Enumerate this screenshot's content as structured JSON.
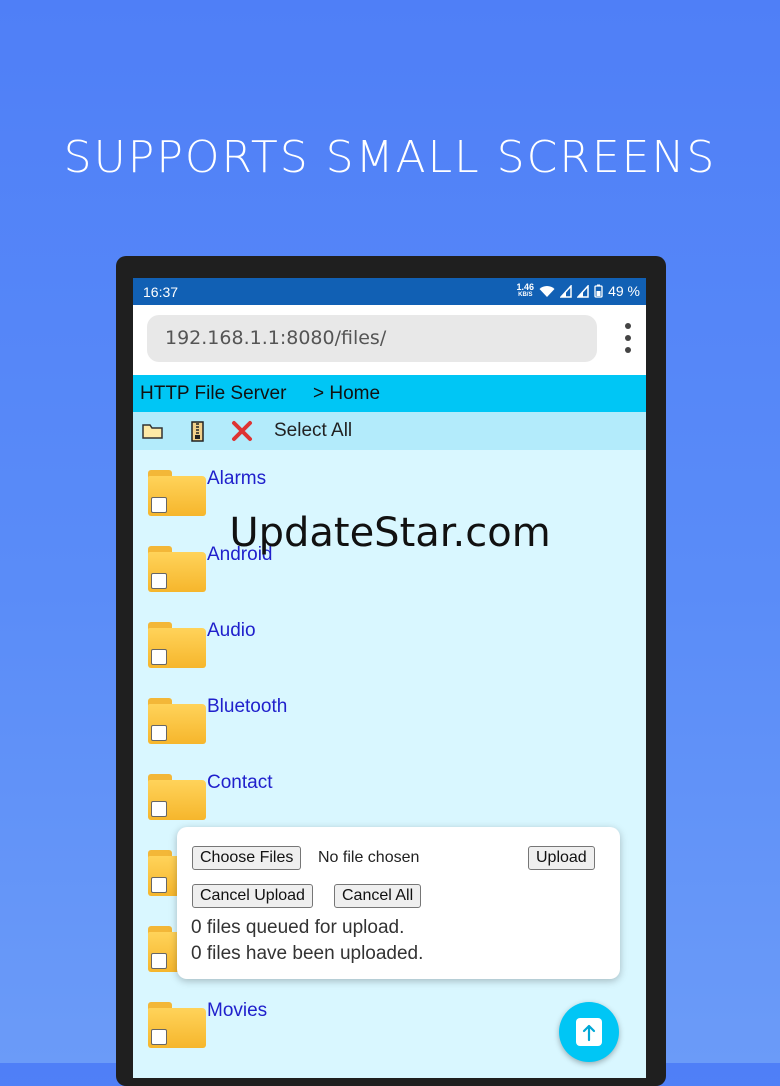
{
  "headline": "SUPPORTS SMALL SCREENS",
  "watermark": "UpdateStar.com",
  "status_bar": {
    "time": "16:37",
    "net_speed_top": "1.46",
    "net_speed_unit": "KB/S",
    "battery": "49 %",
    "icons": [
      "wifi-icon",
      "signal-icon",
      "signal-icon",
      "battery-icon"
    ]
  },
  "browser": {
    "url": "192.168.1.1:8080/files/"
  },
  "app": {
    "title": "HTTP File Server",
    "breadcrumb": "> Home",
    "toolbar": {
      "select_all": "Select All",
      "icons": [
        "new-folder-icon",
        "zip-icon",
        "delete-icon"
      ]
    },
    "folders": [
      {
        "name": "Alarms"
      },
      {
        "name": "Android"
      },
      {
        "name": "Audio"
      },
      {
        "name": "Bluetooth"
      },
      {
        "name": "Contact"
      },
      {
        "name": ""
      },
      {
        "name": ""
      },
      {
        "name": "Movies"
      }
    ]
  },
  "upload": {
    "choose_files": "Choose Files",
    "no_file": "No file chosen",
    "upload": "Upload",
    "cancel_upload": "Cancel Upload",
    "cancel_all": "Cancel All",
    "queued": "0 files queued for upload.",
    "uploaded": "0 files have been uploaded."
  },
  "colors": {
    "background": "#5a8cf8",
    "status_bar": "#1160b4",
    "title_bar": "#00c6f5",
    "toolbar": "#b3ebfb",
    "list_bg": "#d9f7ff",
    "link": "#2020cc",
    "folder": "#f6b62c"
  }
}
